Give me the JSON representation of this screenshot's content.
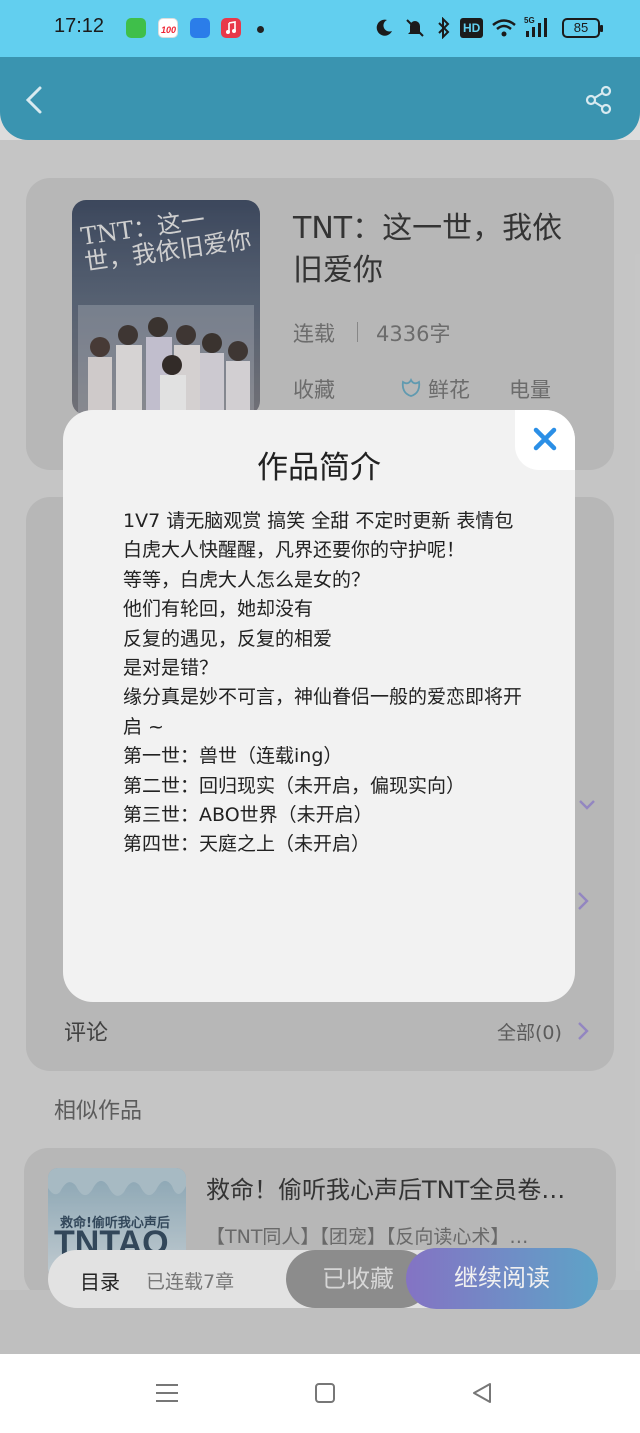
{
  "status_bar": {
    "time": "17:12",
    "app_icons": [
      {
        "name": "grid-app-icon",
        "color": "#3fbf4a"
      },
      {
        "name": "hundred-app-icon",
        "color": "#ffffff"
      },
      {
        "name": "blue-app-icon",
        "color": "#2b7de9"
      },
      {
        "name": "music-app-icon",
        "color": "#e8384a"
      }
    ],
    "battery": "85",
    "hd_label": "HD"
  },
  "header": {
    "background": "#3a94b0"
  },
  "book": {
    "cover_title": "TNT：这一世，我依旧爱你",
    "title": "TNT：这一世，我依旧爱你",
    "status": "连载",
    "word_count": "4336字",
    "stats": {
      "favorites_label": "收藏",
      "flowers_label": "鲜花",
      "power_label": "电量"
    }
  },
  "comments": {
    "label": "评论",
    "all_label": "全部(0)"
  },
  "similar": {
    "section_label": "相似作品",
    "item": {
      "cover_text": "救命!偷听我心声后",
      "cover_big": "TNTAO",
      "title": "救命！偷听我心声后TNT全员卷…",
      "tags": "【TNT同人】【团宠】【反向读心术】…"
    }
  },
  "bottom_bar": {
    "toc_label": "目录",
    "toc_count": "已连载7章",
    "saved_button": "已收藏",
    "read_button": "继续阅读"
  },
  "modal": {
    "title": "作品简介",
    "lines": [
      "1V7 请无脑观赏 搞笑 全甜 不定时更新 表情包",
      "白虎大人快醒醒，凡界还要你的守护呢！",
      "等等，白虎大人怎么是女的？",
      "他们有轮回，她却没有",
      "反复的遇见，反复的相爱",
      "是对是错？",
      "缘分真是妙不可言，神仙眷侣一般的爱恋即将开启 ~",
      "第一世：兽世（连载ing）",
      "第二世：回归现实（未开启，偏现实向）",
      "第三世：ABO世界（未开启）",
      "第四世：天庭之上（未开启）"
    ]
  },
  "colors": {
    "status_bar": "#62cfef",
    "close_icon": "#2b8fe6",
    "read_button_start": "#8473c4",
    "read_button_end": "#5ea3c7"
  }
}
